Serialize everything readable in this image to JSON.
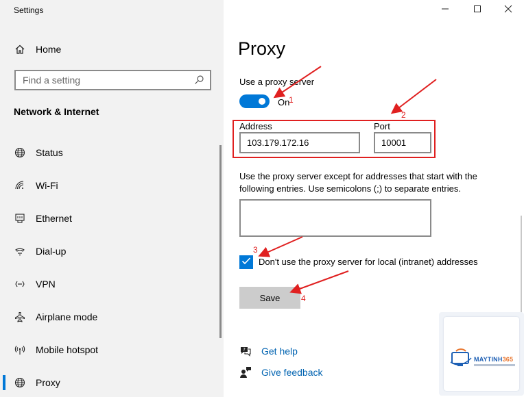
{
  "window": {
    "title": "Settings",
    "controls": [
      "minimize-icon",
      "maximize-icon",
      "close-icon"
    ]
  },
  "sidebar": {
    "home_label": "Home",
    "search_placeholder": "Find a setting",
    "section_title": "Network & Internet",
    "items": [
      {
        "label": "Status",
        "icon": "globe-icon",
        "selected": false
      },
      {
        "label": "Wi-Fi",
        "icon": "wifi-icon",
        "selected": false
      },
      {
        "label": "Ethernet",
        "icon": "ethernet-icon",
        "selected": false
      },
      {
        "label": "Dial-up",
        "icon": "dialup-icon",
        "selected": false
      },
      {
        "label": "VPN",
        "icon": "vpn-icon",
        "selected": false
      },
      {
        "label": "Airplane mode",
        "icon": "airplane-icon",
        "selected": false
      },
      {
        "label": "Mobile hotspot",
        "icon": "hotspot-icon",
        "selected": false
      },
      {
        "label": "Proxy",
        "icon": "globe-icon",
        "selected": true
      }
    ]
  },
  "main": {
    "title": "Proxy",
    "use_proxy_label": "Use a proxy server",
    "toggle_state": "On",
    "address_label": "Address",
    "address_value": "103.179.172.16",
    "port_label": "Port",
    "port_value": "10001",
    "exceptions_description": "Use the proxy server except for addresses that start with the following entries. Use semicolons (;) to separate entries.",
    "exceptions_value": "",
    "local_checkbox_label": "Don't use the proxy server for local (intranet) addresses",
    "local_checkbox_checked": true,
    "save_label": "Save",
    "help_link": "Get help",
    "feedback_link": "Give feedback"
  },
  "annotations": [
    "1",
    "2",
    "3",
    "4"
  ],
  "watermark": {
    "brand_part1": "MAYTINH",
    "brand_part2": "365"
  },
  "colors": {
    "accent": "#0078d7",
    "link": "#0063b1",
    "annotation": "#e02020",
    "sidebar_bg": "#f2f2f2"
  }
}
